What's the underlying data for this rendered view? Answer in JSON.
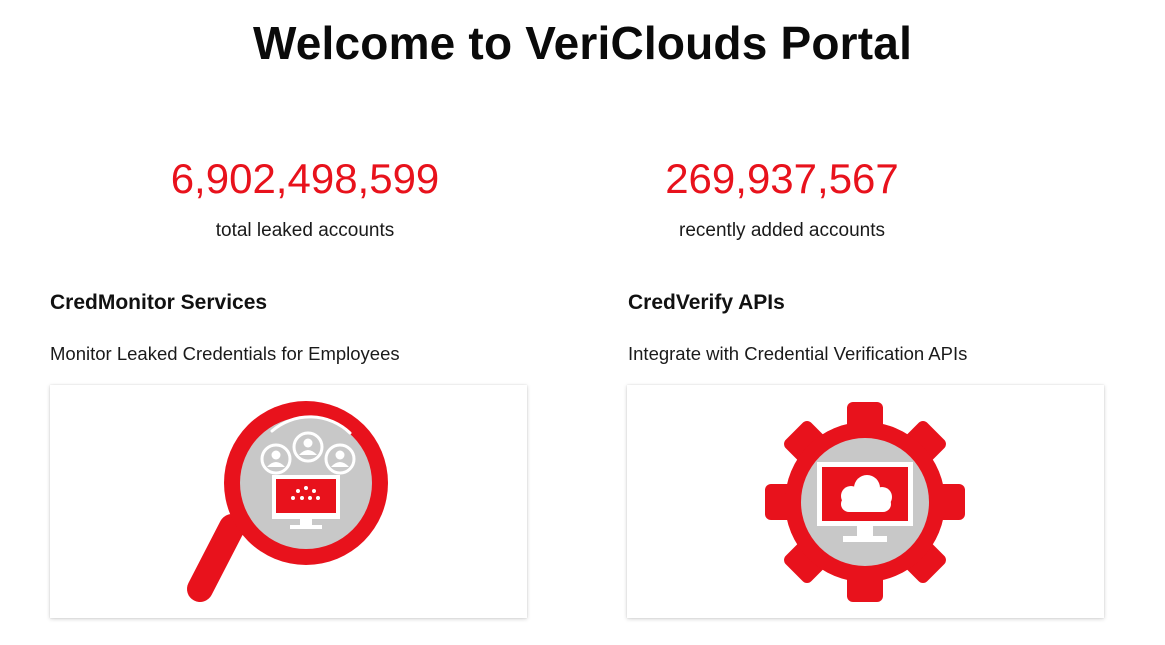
{
  "header": {
    "title": "Welcome to VeriClouds Portal"
  },
  "stats": {
    "total": {
      "value": "6,902,498,599",
      "label": "total leaked accounts"
    },
    "recent": {
      "value": "269,937,567",
      "label": "recently added accounts"
    }
  },
  "services": {
    "credmonitor": {
      "title": "CredMonitor Services",
      "description": "Monitor Leaked Credentials for Employees",
      "icon": "magnifier-monitor-users-icon"
    },
    "credverify": {
      "title": "CredVerify APIs",
      "description": "Integrate with Credential Verification APIs",
      "icon": "gear-monitor-cloud-icon"
    }
  },
  "colors": {
    "accent": "#e8121c",
    "icon_gray": "#c8c8c8"
  }
}
